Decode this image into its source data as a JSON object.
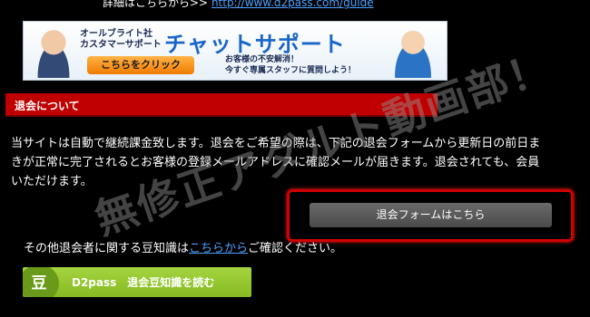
{
  "top_partial": {
    "prefix": "詳細はこちらから>>",
    "link": "http://www.d2pass.com/guide"
  },
  "support_banner": {
    "company_line1": "オールブライト社",
    "company_line2": "カスタマーサポート",
    "title": "チャットサポート",
    "cta": "こちらをクリック",
    "sub_line1": "お客様の不安解消！",
    "sub_line2": "今すぐ専属スタッフに質問しよう！"
  },
  "section": {
    "title": "退会について"
  },
  "body": {
    "line1": "当サイトは自動で継続課金致します。退会をご希望の際は、下記の退会フォームから更新日の前日ま",
    "line2": "きが正常に完了されるとお客様の登録メールアドレスに確認メールが届きます。退会されても、会員",
    "line3": "いただけます。"
  },
  "withdraw_button": {
    "label": "退会フォームはこちら"
  },
  "trivia": {
    "prefix": "その他退会者に関する豆知識は",
    "link": "こちらから",
    "suffix": "ご確認ください。"
  },
  "trivia_button": {
    "icon_char": "豆",
    "label": "D2pass　退会豆知識を読む"
  },
  "watermark": {
    "text": "無修正アダルト動画部！"
  },
  "colors": {
    "background": "#000000",
    "section_header": "#c00000",
    "link": "#4da3ff",
    "focus_ring": "#d10000",
    "trivia_button": "#95c82e"
  }
}
